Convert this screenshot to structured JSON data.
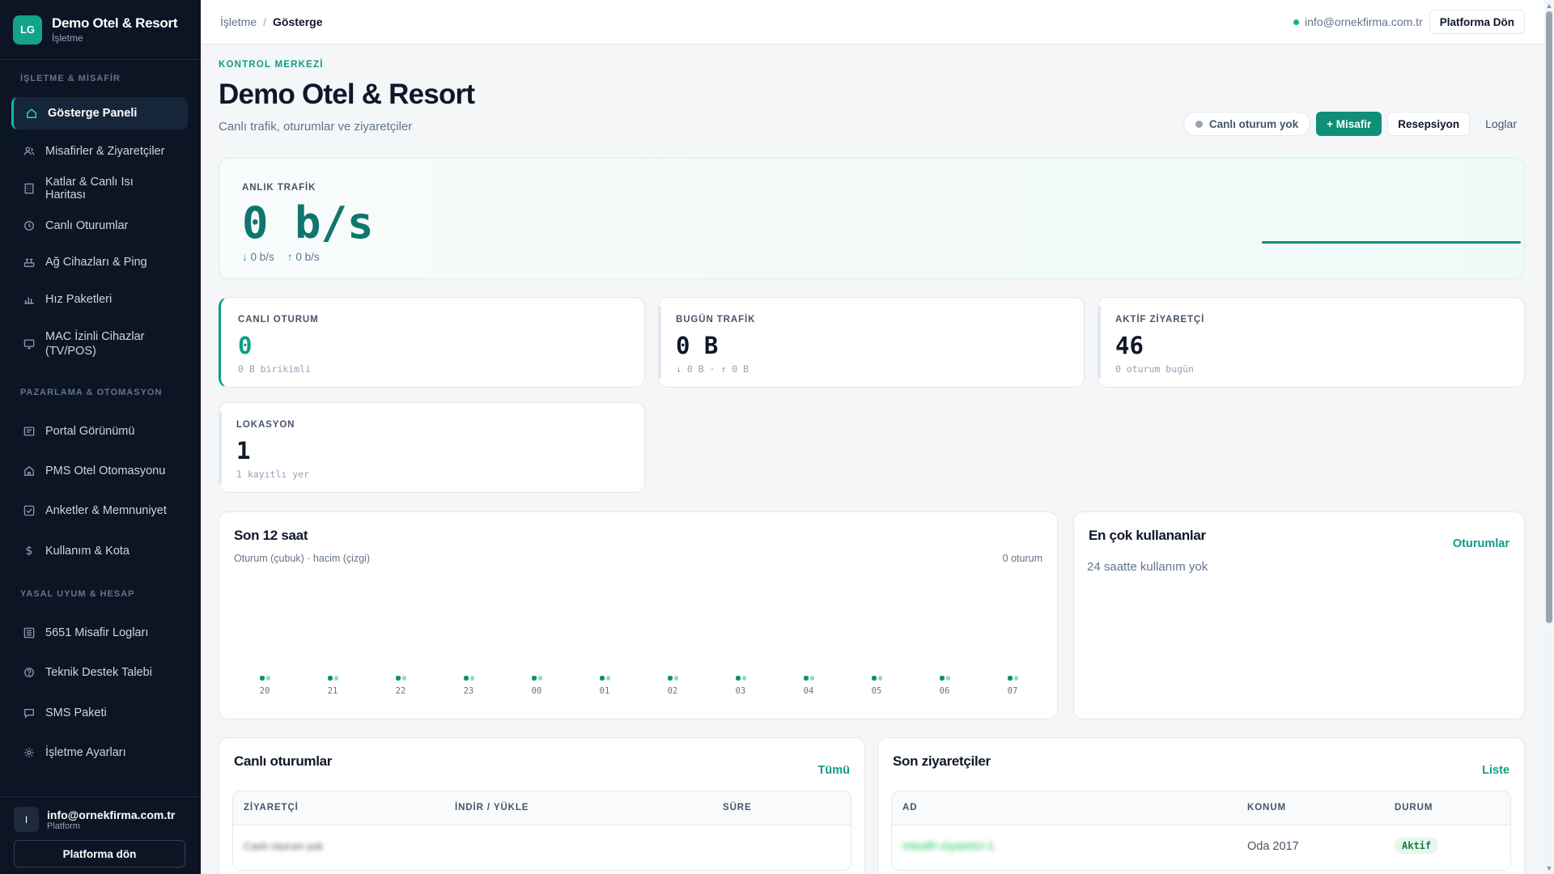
{
  "sidebar": {
    "brand_initials": "LG",
    "brand_name": "Demo Otel & Resort",
    "brand_sub": "İşletme",
    "sections": [
      "İŞLETME & MİSAFİR",
      "PAZARLAMA & OTOMASYON",
      "YASAL UYUM & HESAP"
    ],
    "items": [
      {
        "label": "Gösterge Paneli",
        "icon": "home-icon",
        "active": true
      },
      {
        "label": "Misafirler & Ziyaretçiler",
        "icon": "users-icon"
      },
      {
        "label": "Katlar & Canlı Isı Haritası",
        "icon": "building-icon"
      },
      {
        "label": "Canlı Oturumlar",
        "icon": "clock-icon"
      },
      {
        "label": "Ağ Cihazları & Ping",
        "icon": "router-icon"
      },
      {
        "label": "Hız Paketleri",
        "icon": "bars-icon"
      },
      {
        "label": "MAC İzinli Cihazlar (TV/POS)",
        "icon": "monitor-icon"
      },
      {
        "label": "Portal Görünümü",
        "icon": "layout-icon"
      },
      {
        "label": "PMS Otel Otomasyonu",
        "icon": "hotel-icon"
      },
      {
        "label": "Anketler & Memnuniyet",
        "icon": "checkbox-icon"
      },
      {
        "label": "Kullanım & Kota",
        "icon": "dollar-icon"
      },
      {
        "label": "5651 Misafir Logları",
        "icon": "list-icon"
      },
      {
        "label": "Teknik Destek Talebi",
        "icon": "help-icon"
      },
      {
        "label": "SMS Paketi",
        "icon": "message-icon"
      },
      {
        "label": "İşletme Ayarları",
        "icon": "gear-icon"
      }
    ],
    "footer": {
      "avatar": "I",
      "email": "info@ornekfirma.com.tr",
      "role": "Platform",
      "button": "Platforma dön"
    }
  },
  "topbar": {
    "crumb_root": "İşletme",
    "crumb_sep": "/",
    "crumb_current": "Gösterge",
    "email": "info@ornekfirma.com.tr",
    "button": "Platforma Dön"
  },
  "header": {
    "eyebrow": "KONTROL MERKEZİ",
    "title": "Demo Otel & Resort",
    "subtitle": "Canlı trafik, oturumlar ve ziyaretçiler",
    "status_pill": "Canlı oturum yok",
    "add_guest": "+ Misafir",
    "reception": "Resepsiyon",
    "logs": "Loglar"
  },
  "traffic": {
    "label": "ANLIK TRAFİK",
    "value": "0 b/s",
    "down": "0 b/s",
    "up": "0 b/s"
  },
  "stats": [
    {
      "label": "CANLI OTURUM",
      "value": "0",
      "note": "0 B birikimli"
    },
    {
      "label": "BUGÜN TRAFİK",
      "value": "0 B",
      "note": "↓ 0 B · ↑ 0 B"
    },
    {
      "label": "AKTİF ZİYARETÇİ",
      "value": "46",
      "note": "0 oturum bugün"
    },
    {
      "label": "LOKASYON",
      "value": "1",
      "note": "1 kayıtlı yer"
    }
  ],
  "last12": {
    "title": "Son 12 saat",
    "caption": "Oturum (çubuk) · hacim (çizgi)",
    "count": "0 oturum"
  },
  "chart_data": {
    "type": "bar",
    "categories": [
      "20",
      "21",
      "22",
      "23",
      "00",
      "01",
      "02",
      "03",
      "04",
      "05",
      "06",
      "07"
    ],
    "series": [
      {
        "values": [
          0,
          0,
          0,
          0,
          0,
          0,
          0,
          0,
          0,
          0,
          0,
          0
        ]
      },
      {
        "values": [
          0,
          0,
          0,
          0,
          0,
          0,
          0,
          0,
          0,
          0,
          0,
          0
        ]
      }
    ],
    "colors": [
      "#0f8f78",
      "#9bd8cc"
    ]
  },
  "top_users": {
    "title": "En çok kullananlar",
    "link": "Oturumlar",
    "empty": "24 saatte kullanım yok"
  },
  "live_sessions": {
    "title": "Canlı oturumlar",
    "link": "Tümü",
    "columns": [
      "ZİYARETÇİ",
      "İNDİR / YÜKLE",
      "SÜRE"
    ],
    "empty": "Canlı oturum yok"
  },
  "recent_visitors": {
    "title": "Son ziyaretçiler",
    "link": "Liste",
    "columns": [
      "AD",
      "KONUM",
      "DURUM"
    ],
    "rows": [
      {
        "name": "misafir-ziyaretci-1",
        "location": "Oda 2017",
        "status": "Aktif"
      }
    ]
  },
  "colors": {
    "accent": "#0f9d85",
    "sidebar_bg": "#0c1524",
    "primary_button": "#0f8f78"
  }
}
